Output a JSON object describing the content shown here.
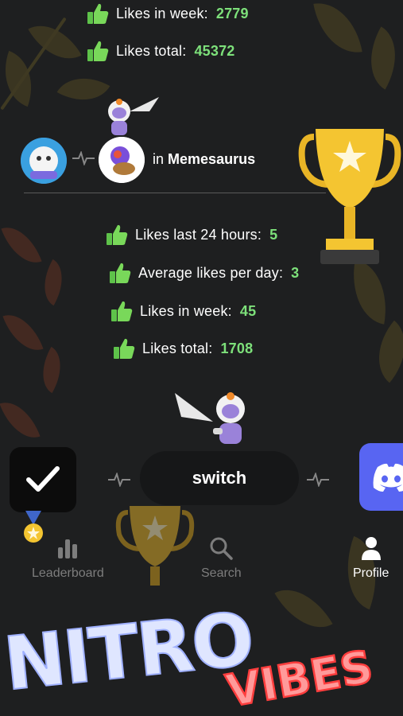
{
  "top_stats": [
    {
      "label": "Likes in week:",
      "value": "2779"
    },
    {
      "label": "Likes total:",
      "value": "45372"
    }
  ],
  "server_line": {
    "prefix": "in",
    "name": "Memesaurus"
  },
  "stats": [
    {
      "label": "Likes last 24 hours:",
      "value": "5"
    },
    {
      "label": "Average likes per day:",
      "value": "3"
    },
    {
      "label": "Likes in week:",
      "value": "45"
    },
    {
      "label": "Likes total:",
      "value": "1708"
    }
  ],
  "switch_label": "switch",
  "tabs": [
    {
      "label": "Leaderboard",
      "icon": "bar-chart-icon",
      "active": false
    },
    {
      "label": "Search",
      "icon": "search-icon",
      "active": false
    },
    {
      "label": "Profile",
      "icon": "person-icon",
      "active": true
    }
  ],
  "overlay": {
    "word1": "NITRO",
    "word2": "VIBES"
  },
  "colors": {
    "accent_green": "#7de07a",
    "discord_blurple": "#5865f2",
    "neon_red": "#ff6a6a",
    "nitro_white": "#dfe6ff"
  }
}
